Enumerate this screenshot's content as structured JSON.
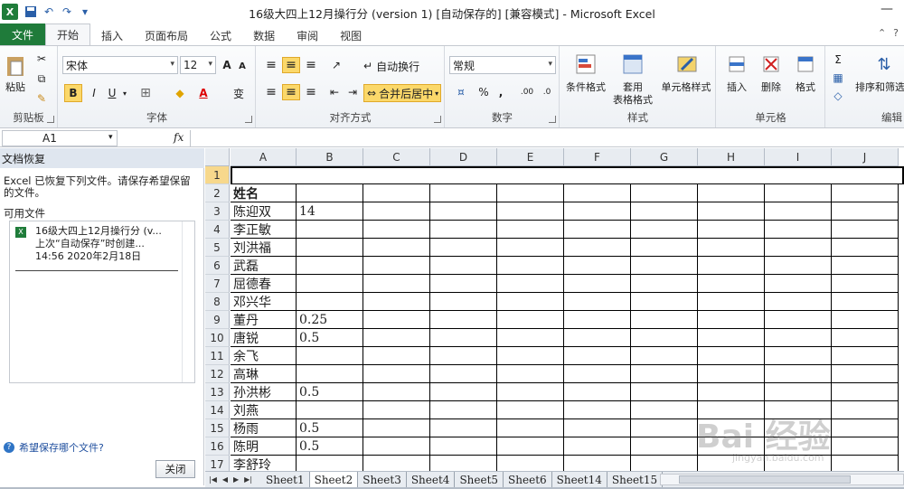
{
  "window": {
    "title": "16级大四上12月操行分 (version 1) [自动保存的]  [兼容模式]  -  Microsoft Excel",
    "app_icon": "X"
  },
  "qat": {
    "save_icon": "save-icon",
    "undo_icon": "undo-icon",
    "redo_icon": "redo-icon"
  },
  "tabs": [
    "文件",
    "开始",
    "插入",
    "页面布局",
    "公式",
    "数据",
    "审阅",
    "视图"
  ],
  "ribbon": {
    "clipboard": {
      "paste": "粘贴",
      "label": "剪贴板"
    },
    "font": {
      "name": "宋体",
      "size": "12",
      "bold": "B",
      "italic": "I",
      "underline": "U",
      "label": "字体",
      "grow": "A",
      "shrink": "A",
      "color_letter": "A",
      "wen": "变"
    },
    "alignment": {
      "wrap": "自动换行",
      "merge": "合并后居中",
      "label": "对齐方式"
    },
    "number": {
      "format": "常规",
      "percent": "%",
      "comma": ",",
      "inc": ".00",
      "dec": ".0",
      "label": "数字"
    },
    "styles": {
      "cond": "条件格式",
      "table1": "套用",
      "table2": "表格格式",
      "cell": "单元格样式",
      "label": "样式"
    },
    "cells": {
      "insert": "插入",
      "delete": "删除",
      "format": "格式",
      "label": "单元格"
    },
    "editing": {
      "sigma": "Σ",
      "sort": "排序和筛选",
      "label": "编辑"
    }
  },
  "formula_bar": {
    "name_box": "A1",
    "fx": "fx"
  },
  "recovery": {
    "title": "文档恢复",
    "description": "Excel 已恢复下列文件。请保存希望保留的文件。",
    "available_label": "可用文件",
    "file_line1": "16级大四上12月操行分 (v...",
    "file_line2": "上次“自动保存”时创建...",
    "file_line3": "14:56 2020年2月18日",
    "help": "希望保存哪个文件?",
    "close": "关闭"
  },
  "grid": {
    "columns": [
      "A",
      "B",
      "C",
      "D",
      "E",
      "F",
      "G",
      "H",
      "I",
      "J"
    ],
    "rows": [
      {
        "n": "1",
        "a": "",
        "b": ""
      },
      {
        "n": "2",
        "a": "姓名",
        "b": ""
      },
      {
        "n": "3",
        "a": "陈迎双",
        "b": "14"
      },
      {
        "n": "4",
        "a": "李正敏",
        "b": ""
      },
      {
        "n": "5",
        "a": "刘洪福",
        "b": ""
      },
      {
        "n": "6",
        "a": "武磊",
        "b": ""
      },
      {
        "n": "7",
        "a": "屈德春",
        "b": ""
      },
      {
        "n": "8",
        "a": "邓兴华",
        "b": ""
      },
      {
        "n": "9",
        "a": "董丹",
        "b": "0.25"
      },
      {
        "n": "10",
        "a": "唐锐",
        "b": "0.5"
      },
      {
        "n": "11",
        "a": "余飞",
        "b": ""
      },
      {
        "n": "12",
        "a": "高琳",
        "b": ""
      },
      {
        "n": "13",
        "a": "孙洪彬",
        "b": "0.5"
      },
      {
        "n": "14",
        "a": "刘燕",
        "b": ""
      },
      {
        "n": "15",
        "a": "杨雨",
        "b": "0.5"
      },
      {
        "n": "16",
        "a": "陈明",
        "b": "0.5"
      },
      {
        "n": "17",
        "a": "李舒玲",
        "b": ""
      }
    ]
  },
  "sheets": [
    "Sheet1",
    "Sheet2",
    "Sheet3",
    "Sheet4",
    "Sheet5",
    "Sheet6",
    "Sheet14",
    "Sheet15"
  ],
  "active_sheet": "Sheet2",
  "watermark": {
    "text": "Bai 经验",
    "sub": "jingyan.baidu.com"
  }
}
